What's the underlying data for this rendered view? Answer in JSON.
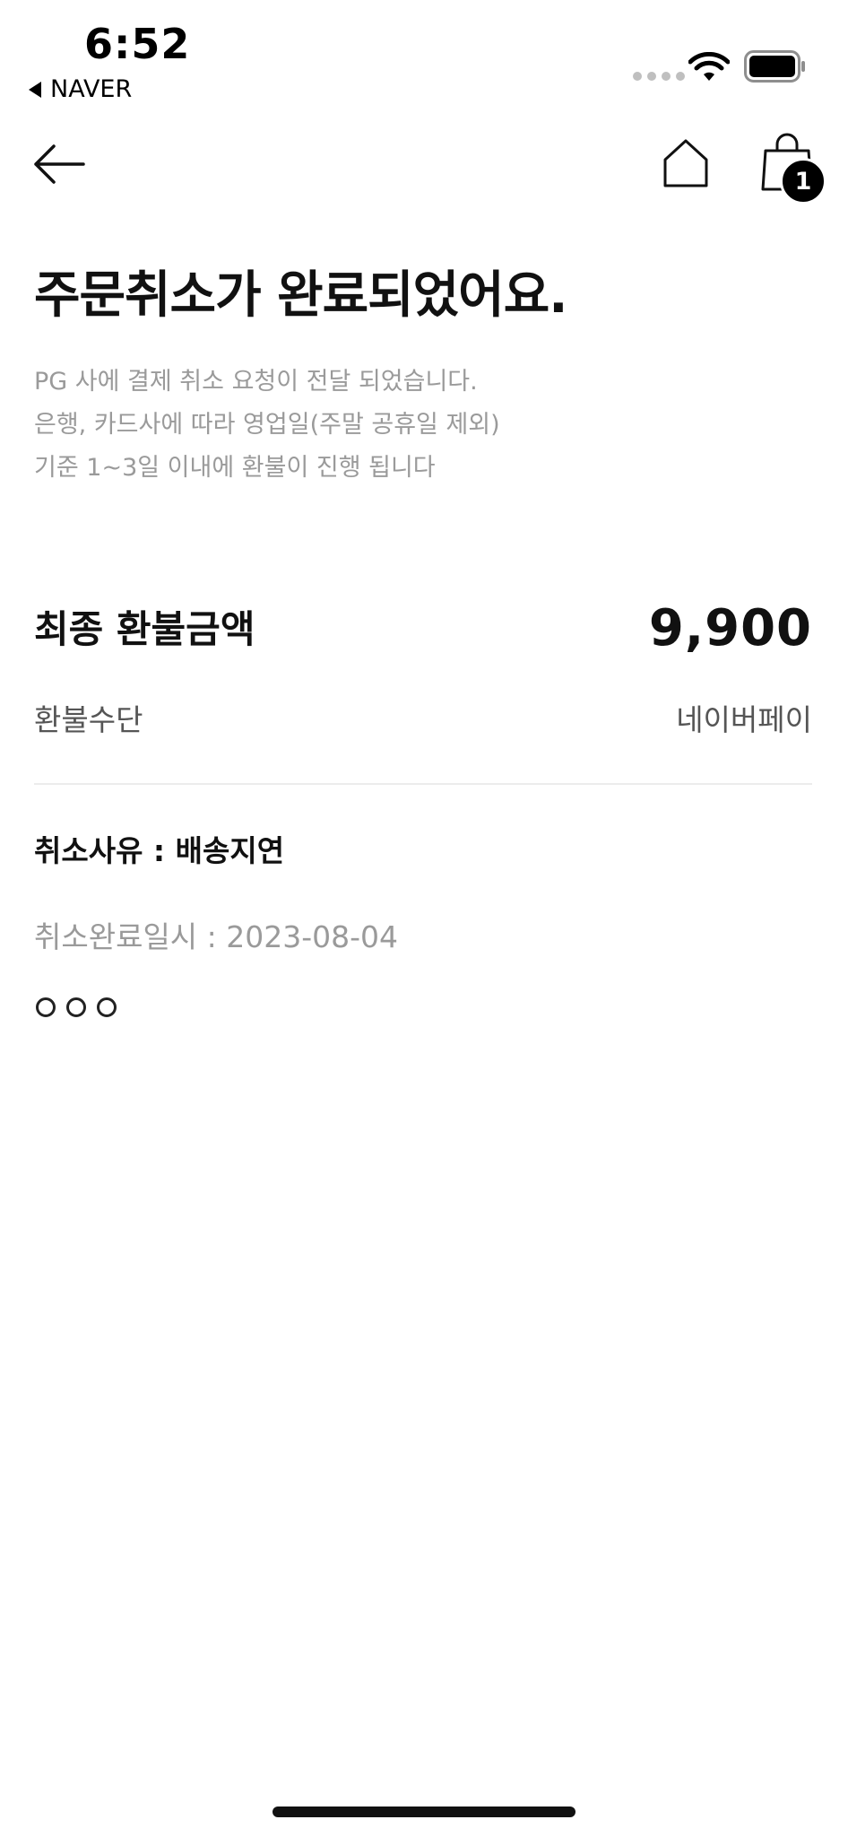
{
  "status_bar": {
    "time": "6:52",
    "back_app": "NAVER"
  },
  "nav": {
    "back_icon": "arrow-left-icon",
    "home_icon": "home-icon",
    "cart_icon": "shopping-bag-icon",
    "cart_count": "1"
  },
  "main": {
    "title": "주문취소가 완료되었어요.",
    "description": [
      "PG 사에 결제 취소 요청이 전달 되었습니다.",
      "은행, 카드사에 따라 영업일(주말 공휴일 제외)",
      "기준 1~3일 이내에 환불이 진행 됩니다"
    ]
  },
  "refund": {
    "final_label": "최종 환불금액",
    "final_amount": "9,900",
    "method_label": "환불수단",
    "method_value": "네이버페이"
  },
  "cancel_info": {
    "reason": "취소사유 : 배송지연",
    "completed_at": "취소완료일시 : 2023-08-04"
  },
  "colors": {
    "primary_text": "#111111",
    "secondary_text": "#9a9a9a",
    "divider": "#ececec"
  }
}
